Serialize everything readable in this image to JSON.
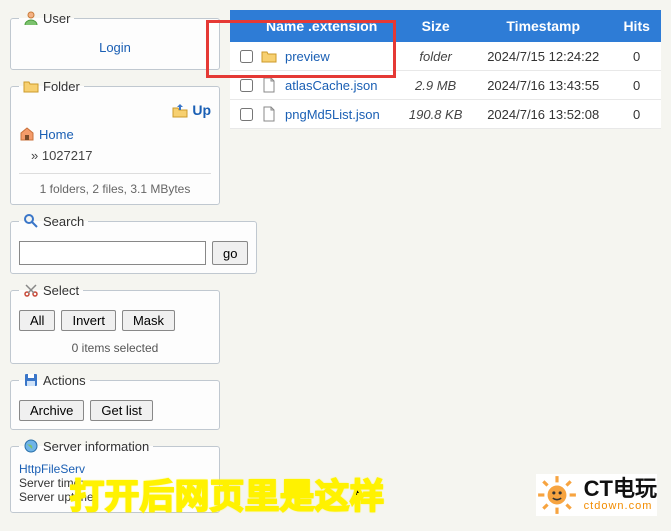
{
  "sidebar": {
    "user": {
      "legend": "User",
      "login": "Login"
    },
    "folder": {
      "legend": "Folder",
      "up": "Up",
      "home": "Home",
      "current": "1027217",
      "summary": "1 folders, 2 files, 3.1 MBytes"
    },
    "search": {
      "legend": "Search",
      "placeholder": "",
      "go": "go"
    },
    "select": {
      "legend": "Select",
      "all": "All",
      "invert": "Invert",
      "mask": "Mask",
      "status": "0 items selected"
    },
    "actions": {
      "legend": "Actions",
      "archive": "Archive",
      "getlist": "Get list"
    },
    "server": {
      "legend": "Server information",
      "product": "HttpFileServ",
      "time_label": "Server time:",
      "uptime_label": "Server uptime:"
    }
  },
  "table": {
    "headers": {
      "name": "Name .extension",
      "size": "Size",
      "ts": "Timestamp",
      "hits": "Hits"
    },
    "rows": [
      {
        "name": "preview",
        "kind": "folder",
        "size": "folder",
        "ts": "2024/7/15 12:24:22",
        "hits": "0"
      },
      {
        "name": "atlasCache.json",
        "kind": "file",
        "size": "2.9 MB",
        "ts": "2024/7/16 13:43:55",
        "hits": "0"
      },
      {
        "name": "pngMd5List.json",
        "kind": "file",
        "size": "190.8 KB",
        "ts": "2024/7/16 13:52:08",
        "hits": "0"
      }
    ]
  },
  "caption": "打开后网页里是这样",
  "logo": {
    "brand": "CT电玩",
    "sub": "ctdown.com"
  }
}
